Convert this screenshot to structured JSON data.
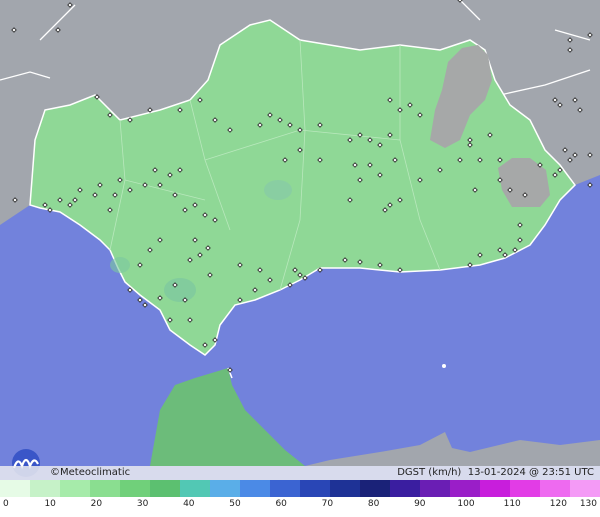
{
  "map": {
    "colors": {
      "sea": "#7282dc",
      "land_outside": "#a2a6ad",
      "region_fill": "#8fd896",
      "region_dark": "#6cbc7a",
      "mountain": "#a6a8a8",
      "border": "#ffffff"
    },
    "station_marker": "diamond"
  },
  "footer": {
    "credit": "©Meteoclimatic",
    "variable": "DGST (km/h)",
    "datetime": "13-01-2024 @ 23:51 UTC"
  },
  "legend": {
    "ticks": [
      "0",
      "10",
      "20",
      "30",
      "40",
      "50",
      "60",
      "70",
      "80",
      "90",
      "100",
      "110",
      "120",
      "130"
    ],
    "colors": [
      "#e6fbe6",
      "#c6f2c8",
      "#a6ebaa",
      "#8ade90",
      "#70d07a",
      "#5cc070",
      "#52c8b4",
      "#5aaee8",
      "#4b8ae6",
      "#3b64d2",
      "#2946b6",
      "#1e3296",
      "#1a2278",
      "#3a1ea0",
      "#6a1eb4",
      "#9a1ec8",
      "#c81edc",
      "#e23ce6",
      "#ee6af0",
      "#f49af6"
    ]
  }
}
